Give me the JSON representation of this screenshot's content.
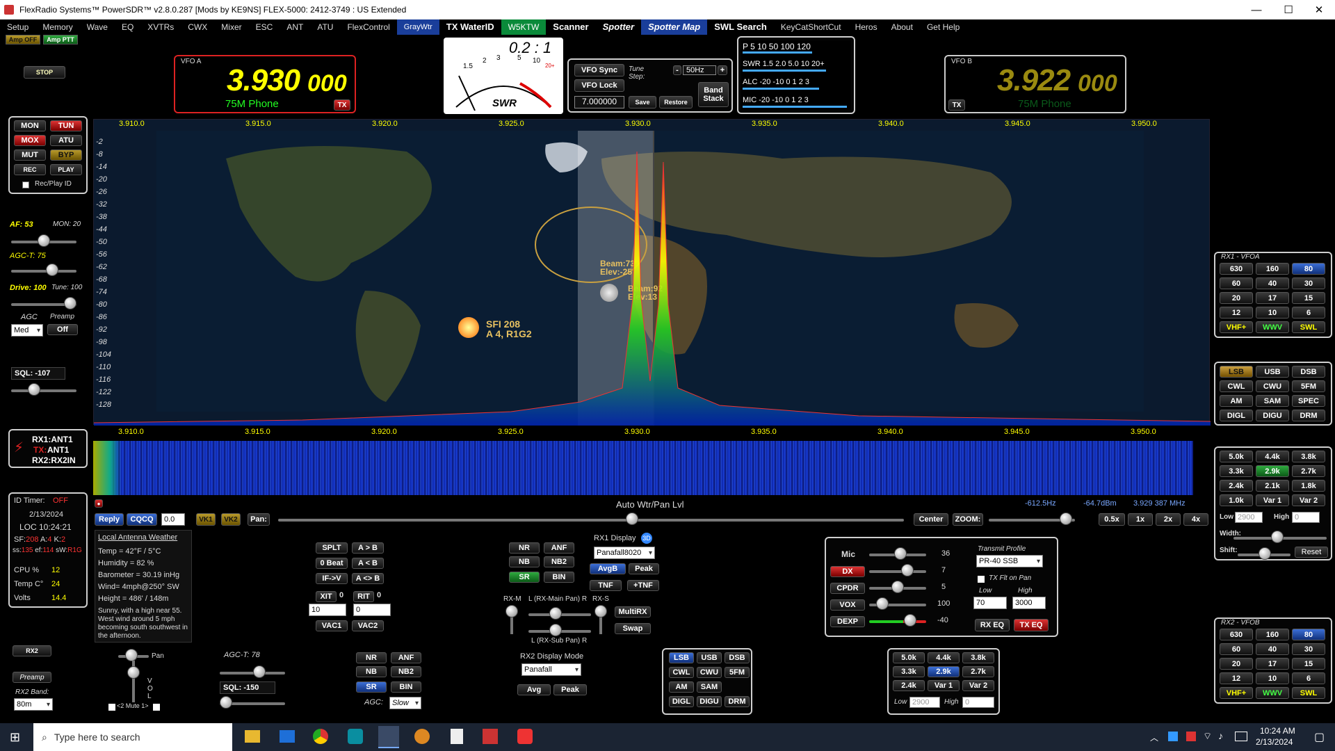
{
  "window": {
    "title": "FlexRadio Systems™  PowerSDR™ v2.8.0.287  [Mods by KE9NS]   FLEX-5000: 2412-3749 : US Extended",
    "minimize": "—",
    "maximize": "☐",
    "close": "✕"
  },
  "menu": [
    "Setup",
    "Memory",
    "Wave",
    "EQ",
    "XVTRs",
    "CWX",
    "Mixer",
    "ESC",
    "ANT",
    "ATU",
    "FlexControl",
    "GrayWtr",
    "TX WaterID",
    "W5KTW",
    "Scanner",
    "Spotter",
    "Spotter Map",
    "SWL Search",
    "KeyCatShortCut",
    "Heros",
    "About",
    "Get Help"
  ],
  "amp": {
    "off": "Amp OFF",
    "ptt": "Amp PTT"
  },
  "stop": "STOP",
  "vfoA": {
    "label": "VFO A",
    "mhz": "3.930",
    "khz": "000",
    "mode": "75M Phone",
    "tx": "TX"
  },
  "vfoB": {
    "label": "VFO B",
    "mhz": "3.922",
    "khz": "000",
    "mode": "75M Phone",
    "tx": "TX"
  },
  "swr": {
    "ratio": "0.2 : 1",
    "label": "SWR",
    "scale": [
      "1.5",
      "2",
      "3",
      "5",
      "10",
      "20+"
    ]
  },
  "vfoctl": {
    "sync": "VFO Sync",
    "lock": "VFO Lock",
    "tune_step_label": "Tune Step:",
    "tune_step": "50Hz",
    "minus": "-",
    "plus": "+",
    "band_stack": "Band Stack",
    "freq": "7.000000",
    "save": "Save",
    "restore": "Restore"
  },
  "meter": {
    "p_scale": "P  5   10   50   100 120",
    "swr_scale": "SWR 1.5  2.0   5.0  10  20+",
    "alc_scale": "ALC -20     -10     0  1 2 3",
    "mic_scale": "MIC -20     -10     0  1 2 3"
  },
  "freq_axis": [
    "3.910.0",
    "3.915.0",
    "3.920.0",
    "3.925.0",
    "3.930.0",
    "3.935.0",
    "3.940.0",
    "3.945.0",
    "3.950.0"
  ],
  "db_axis": [
    "-2",
    "-8",
    "-14",
    "-20",
    "-26",
    "-32",
    "-38",
    "-44",
    "-50",
    "-56",
    "-62",
    "-68",
    "-74",
    "-80",
    "-86",
    "-92",
    "-98",
    "-104",
    "-110",
    "-116",
    "-122",
    "-128"
  ],
  "map": {
    "beam1": "Beam:73",
    "elev1": "Elev:-25",
    "beam2": "Beam:92",
    "elev2": "Elev:13",
    "sfi": "SFI 208",
    "aindex": "A 4, R1G2"
  },
  "left": {
    "mon": "MON",
    "tun": "TUN",
    "mox": "MOX",
    "atu": "ATU",
    "mut": "MUT",
    "byp": "BYP",
    "rec": "REC",
    "play": "PLAY",
    "recplay": "Rec/Play ID",
    "af": "AF: 53",
    "mon_val": "MON: 20",
    "agct": "AGC-T:  75",
    "drive": "Drive: 100",
    "tune": "Tune: 100",
    "agc_label": "AGC",
    "preamp_label": "Preamp",
    "agc_val": "Med",
    "preamp_val": "Off",
    "sql": "SQL: -107",
    "ant_rx1": "RX1:ANT1",
    "ant_tx_label": "TX:",
    "ant_tx": "ANT1",
    "ant_rx2": "RX2:RX2IN"
  },
  "info": {
    "id_label": "ID Timer:",
    "id_val": "OFF",
    "date": "2/13/2024",
    "loc": "LOC  10:24:21",
    "sf_label": "SF:",
    "sf": "208",
    "a_label": "A:",
    "a": "4",
    "k_label": "K:",
    "k": "2",
    "ss_label": "ss:",
    "ss": "135",
    "ef_label": "ef:",
    "ef": "114",
    "sw_label": "sW:",
    "sw": "R1G",
    "cpu_label": "CPU %",
    "cpu": "12",
    "temp_label": "Temp C°",
    "temp": "24",
    "volts_label": "Volts",
    "volts": "14.4"
  },
  "weather": {
    "title": "Local Antenna Weather",
    "lines": [
      "Temp = 42°F / 5°C",
      "Humidity = 82 %",
      "Barometer = 30.19 inHg",
      "Wind= 4mph@250° SW",
      "Height = 486' / 148m",
      "Sunny, with a high near 55. West wind around 5 mph becoming south southwest in the afternoon."
    ]
  },
  "ctrlbar": {
    "reply": "Reply",
    "cqcq": "CQCQ",
    "num": "0.0",
    "vk1": "VK1",
    "vk2": "VK2",
    "pan": "Pan:",
    "wtr_label": "Auto Wtr/Pan Lvl",
    "center": "Center",
    "zoom": "ZOOM:",
    "z05": "0.5x",
    "z1": "1x",
    "z2": "2x",
    "z4": "4x",
    "offset": "-612.5Hz",
    "dbm": "-64.7dBm",
    "cursor": "3.929 387 MHz"
  },
  "split": {
    "splt": "SPLT",
    "atob": "A > B",
    "zerobeat": "0 Beat",
    "altb": "A < B",
    "ifv": "IF->V",
    "aswap": "A <> B",
    "xit": "XIT",
    "xit_val": "0",
    "rit": "RIT",
    "rit_val": "0",
    "xit_step": "10",
    "rit_step": "0",
    "vac1": "VAC1",
    "vac2": "VAC2"
  },
  "dsp1": {
    "nr": "NR",
    "anf": "ANF",
    "nb": "NB",
    "nb2": "NB2",
    "sr": "SR",
    "bin": "BIN"
  },
  "display1": {
    "label": "RX1 Display",
    "mode": "Panafall8020",
    "avgb": "AvgB",
    "peak": "Peak",
    "tnf": "TNF",
    "tnfplus": "+TNF",
    "multirx": "MultiRX",
    "swap": "Swap",
    "rxm": "RX-M",
    "rxs": "RX-S",
    "mainpan": "L (RX-Main Pan) R",
    "subpan": "L (RX-Sub Pan) R"
  },
  "display2": {
    "label": "RX2 Display Mode",
    "mode": "Panafall",
    "avg": "Avg",
    "peak": "Peak"
  },
  "tx": {
    "mic": "Mic",
    "mic_val": "36",
    "dx": "DX",
    "dx_val": "7",
    "cpdr": "CPDR",
    "cpdr_val": "5",
    "vox": "VOX",
    "vox_val": "100",
    "dexp": "DEXP",
    "dexp_val": "-40",
    "profile_label": "Transmit Profile",
    "profile": "PR-40 SSB",
    "txflt": "TX Flt on Pan",
    "low_label": "Low",
    "high_label": "High",
    "low": "70",
    "high": "3000",
    "rxeq": "RX EQ",
    "txeq": "TX EQ"
  },
  "rx1band": {
    "title": "RX1 - VFOA",
    "bands": [
      "630",
      "160",
      "80",
      "60",
      "40",
      "30",
      "20",
      "17",
      "15",
      "12",
      "10",
      "6",
      "VHF+",
      "WWV",
      "SWL"
    ],
    "active": "80"
  },
  "rx2band": {
    "title": "RX2 - VFOB",
    "bands": [
      "630",
      "160",
      "80",
      "60",
      "40",
      "30",
      "20",
      "17",
      "15",
      "12",
      "10",
      "6",
      "VHF+",
      "WWV",
      "SWL"
    ],
    "active": "80"
  },
  "modes": [
    "LSB",
    "USB",
    "DSB",
    "CWL",
    "CWU",
    "5FM",
    "AM",
    "SAM",
    "SPEC",
    "DIGL",
    "DIGU",
    "DRM"
  ],
  "modes2": [
    "LSB",
    "USB",
    "DSB",
    "CWL",
    "CWU",
    "5FM",
    "AM",
    "SAM",
    "DIGL",
    "DIGU",
    "DRM"
  ],
  "filters": [
    "5.0k",
    "4.4k",
    "3.8k",
    "3.3k",
    "2.9k",
    "2.7k",
    "2.4k",
    "2.1k",
    "1.8k",
    "1.0k",
    "Var 1",
    "Var 2"
  ],
  "filters2": [
    "5.0k",
    "4.4k",
    "3.8k",
    "3.3k",
    "2.9k",
    "2.7k",
    "2.4k",
    "Var 1",
    "Var 2"
  ],
  "filt": {
    "low": "Low",
    "low_val": "2900",
    "high": "High",
    "high_val": "0",
    "width": "Width:",
    "shift": "Shift:",
    "reset": "Reset"
  },
  "rx2": {
    "rx2": "RX2",
    "preamp": "Preamp",
    "band_label": "RX2 Band:",
    "band": "80m",
    "pan": "Pan",
    "vol": "V O L",
    "mute": "<2 Mute 1>",
    "agct": "AGC-T:  78",
    "sql": "SQL: -150",
    "agc_label": "AGC:",
    "agc": "Slow"
  },
  "dsp2": {
    "nr": "NR",
    "anf": "ANF",
    "nb": "NB",
    "nb2": "NB2",
    "sr": "SR",
    "bin": "BIN"
  },
  "taskbar": {
    "search": "Type here to search",
    "time": "10:24 AM",
    "date": "2/13/2024"
  }
}
